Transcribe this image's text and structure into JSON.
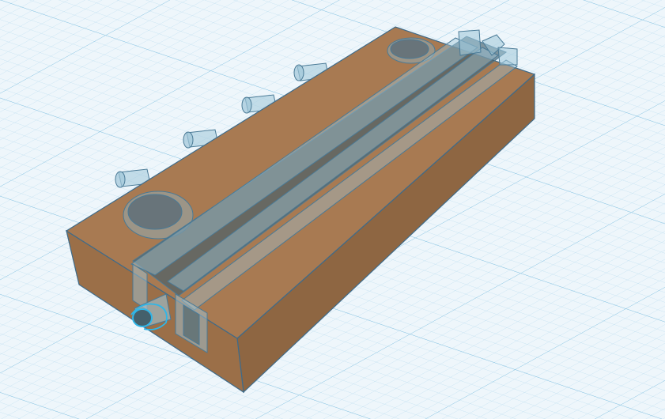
{
  "workplane": {
    "colors": {
      "background": "#eef6fb",
      "grid_minor": "#b8dcef",
      "grid_major": "#7fbfe0"
    }
  },
  "model": {
    "colors": {
      "block_top": "#a87a52",
      "block_side_front": "#9b6f48",
      "block_side_right": "#8e6642",
      "block_edge": "#3e6b8a",
      "hole": "#5f6f78",
      "hole_glass": "#8fb5c8",
      "glass_fill": "#9fc6d8",
      "glass_dark": "#44606b",
      "glass_edge": "#4a7a96",
      "selection_outline": "#2fb6e8"
    },
    "pegs": [
      "peg-1",
      "peg-2",
      "peg-3",
      "peg-4"
    ]
  }
}
